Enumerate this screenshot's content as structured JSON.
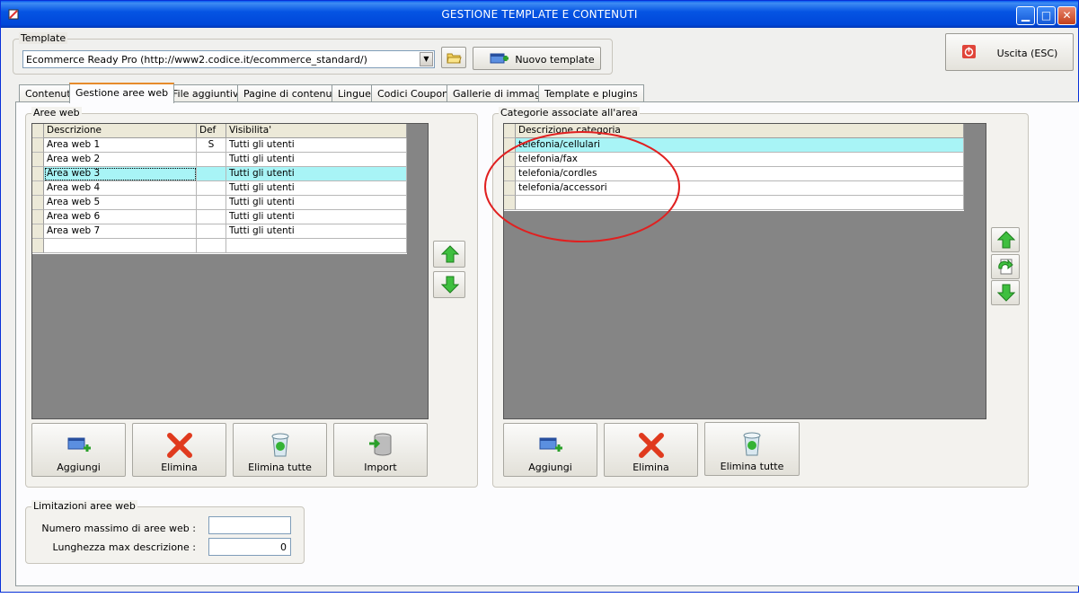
{
  "window": {
    "title": "GESTIONE TEMPLATE E CONTENUTI"
  },
  "template": {
    "group_label": "Template",
    "selected": "Ecommerce Ready Pro (http://www2.codice.it/ecommerce_standard/)",
    "new_button": "Nuovo template"
  },
  "exit_button": "Uscita (ESC)",
  "tabs": [
    {
      "label": "Contenuti"
    },
    {
      "label": "Gestione aree web"
    },
    {
      "label": "File aggiuntivi"
    },
    {
      "label": "Pagine di contenuti"
    },
    {
      "label": "Lingue"
    },
    {
      "label": "Codici Coupon"
    },
    {
      "label": "Gallerie di immagini"
    },
    {
      "label": "Template e plugins"
    }
  ],
  "aree_web": {
    "group_label": "Aree web",
    "columns": [
      "Descrizione",
      "Def",
      "Visibilita'"
    ],
    "rows": [
      {
        "descrizione": "Area web 1",
        "def": "S",
        "visibilita": "Tutti gli utenti"
      },
      {
        "descrizione": "Area web 2",
        "def": "",
        "visibilita": "Tutti gli utenti"
      },
      {
        "descrizione": "Area web 3",
        "def": "",
        "visibilita": "Tutti gli utenti"
      },
      {
        "descrizione": "Area web 4",
        "def": "",
        "visibilita": "Tutti gli utenti"
      },
      {
        "descrizione": "Area web 5",
        "def": "",
        "visibilita": "Tutti gli utenti"
      },
      {
        "descrizione": "Area web 6",
        "def": "",
        "visibilita": "Tutti gli utenti"
      },
      {
        "descrizione": "Area web 7",
        "def": "",
        "visibilita": "Tutti gli utenti"
      }
    ],
    "selected_row": 3,
    "buttons": {
      "aggiungi": "Aggiungi",
      "elimina": "Elimina",
      "elimina_tutte": "Elimina tutte",
      "import": "Import"
    }
  },
  "categorie": {
    "group_label": "Categorie associate all'area",
    "columns": [
      "Descrizione categoria"
    ],
    "rows": [
      {
        "descrizione": "telefonia/cellulari"
      },
      {
        "descrizione": "telefonia/fax"
      },
      {
        "descrizione": "telefonia/cordles"
      },
      {
        "descrizione": "telefonia/accessori"
      }
    ],
    "selected_row": 1,
    "buttons": {
      "aggiungi": "Aggiungi",
      "elimina": "Elimina",
      "elimina_tutte": "Elimina tutte"
    }
  },
  "limitazioni": {
    "group_label": "Limitazioni aree web",
    "max_aree_label": "Numero massimo di aree web :",
    "max_aree_value": "",
    "max_len_label": "Lunghezza max descrizione :",
    "max_len_value": "0"
  },
  "colors": {
    "titlebar": "#0554e3",
    "selected_row": "#a8f4f6",
    "annotation_circle": "#e02020",
    "grid_background": "#858585"
  }
}
